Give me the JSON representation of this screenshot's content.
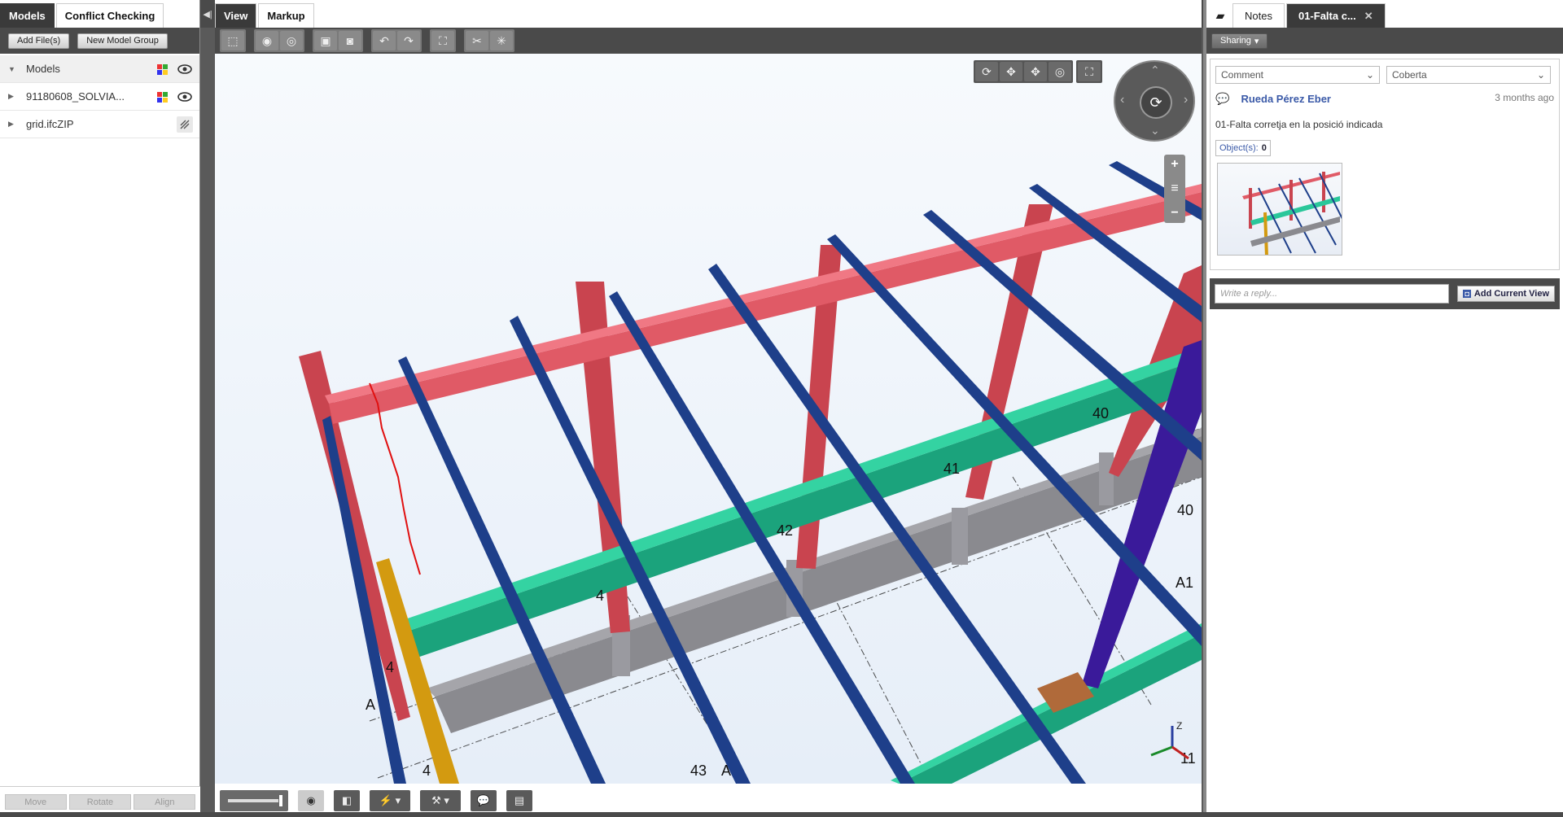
{
  "left_panel": {
    "tabs": [
      "Models",
      "Conflict Checking"
    ],
    "buttons": {
      "add_files": "Add File(s)",
      "new_group": "New Model Group"
    },
    "tree": [
      {
        "label": "Models",
        "expanded": true
      },
      {
        "label": "91180608_SOLVIA...",
        "expanded": false
      },
      {
        "label": "grid.ifcZIP",
        "expanded": false
      }
    ],
    "footer": {
      "move": "Move",
      "rotate": "Rotate",
      "align": "Align"
    }
  },
  "center": {
    "tabs": [
      "View",
      "Markup"
    ],
    "toolbar_icons": [
      "select-box-icon",
      "hide-icon",
      "isolate-icon",
      "camera-icon",
      "snapshot-icon",
      "undo-icon",
      "redo-icon",
      "fit-icon",
      "cut-icon",
      "section-icon"
    ],
    "nav_icons": [
      "orbit-icon",
      "pan-icon",
      "pan2-icon",
      "lookaround-icon",
      "fullscreen-icon"
    ],
    "grid_labels": [
      "40",
      "41",
      "42",
      "40",
      "A1",
      "A",
      "4",
      "4",
      "4",
      "43",
      "A",
      "11"
    ],
    "axis_label": "Z"
  },
  "right_panel": {
    "tabs": [
      "Notes",
      "01-Falta c..."
    ],
    "sharing": "Sharing",
    "type_select": "Comment",
    "category_select": "Coberta",
    "author": "Rueda Pérez Eber",
    "time": "3 months ago",
    "text": "01-Falta corretja en la posició indicada",
    "objects_label": "Object(s):",
    "objects_count": "0",
    "reply_placeholder": "Write a reply...",
    "add_view": "Add Current View"
  },
  "colors": {
    "beam_red": "#d9515d",
    "beam_blue": "#1e3f8a",
    "beam_green": "#1fba8c",
    "beam_gray": "#8a8a8f",
    "column_purple": "#3a1a9a",
    "accent": "#3b5aa8"
  }
}
